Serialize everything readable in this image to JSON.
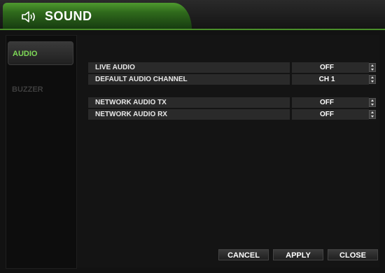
{
  "header": {
    "title": "SOUND",
    "icon": "speaker-icon",
    "accent": "#4a8f2a"
  },
  "sidebar": {
    "items": [
      {
        "label": "AUDIO",
        "active": true,
        "color": "#7ed957"
      },
      {
        "label": "BUZZER",
        "active": false,
        "color": "#3e3e3e"
      }
    ]
  },
  "settings": [
    {
      "label": "LIVE AUDIO",
      "value": "OFF"
    },
    {
      "label": "DEFAULT AUDIO CHANNEL",
      "value": "CH 1"
    },
    {
      "label": "NETWORK AUDIO TX",
      "value": "OFF"
    },
    {
      "label": "NETWORK AUDIO RX",
      "value": "OFF"
    }
  ],
  "buttons": {
    "cancel": "CANCEL",
    "apply": "APPLY",
    "close": "CLOSE"
  }
}
